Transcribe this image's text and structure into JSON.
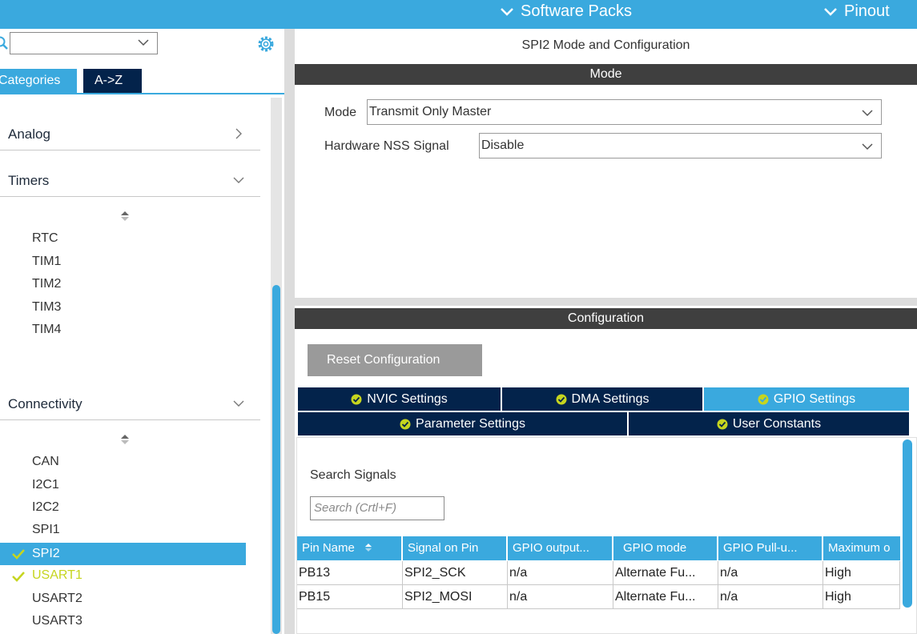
{
  "topbar": {
    "software_packs": "Software Packs",
    "pinout": "Pinout"
  },
  "sidebar": {
    "tabs": {
      "categories": "Categories",
      "az": "A->Z"
    },
    "categories": [
      {
        "label": "Analog",
        "state": "collapsed"
      },
      {
        "label": "Timers",
        "state": "expanded"
      },
      {
        "label": "Connectivity",
        "state": "expanded"
      }
    ],
    "timers_items": [
      "RTC",
      "TIM1",
      "TIM2",
      "TIM3",
      "TIM4"
    ],
    "connectivity_items": [
      "CAN",
      "I2C1",
      "I2C2",
      "SPI1",
      "SPI2",
      "USART1",
      "USART2",
      "USART3"
    ],
    "selected_item": "SPI2"
  },
  "main": {
    "title": "SPI2 Mode and Configuration",
    "mode_header": "Mode",
    "mode_label": "Mode",
    "mode_value": "Transmit Only Master",
    "nss_label": "Hardware NSS Signal",
    "nss_value": "Disable",
    "config_header": "Configuration",
    "reset_button": "Reset Configuration",
    "tabs": {
      "nvic": "NVIC Settings",
      "dma": "DMA Settings",
      "gpio": "GPIO Settings",
      "parameter": "Parameter Settings",
      "user_constants": "User Constants"
    },
    "active_tab": "GPIO Settings",
    "search_label": "Search Signals",
    "search_placeholder": "Search (Crtl+F)",
    "table": {
      "headers": [
        "Pin Name",
        "Signal on Pin",
        "GPIO output...",
        "GPIO mode",
        "GPIO Pull-u...",
        "Maximum o"
      ],
      "rows": [
        [
          "PB13",
          "SPI2_SCK",
          "n/a",
          "Alternate Fu...",
          "n/a",
          "High"
        ],
        [
          "PB15",
          "SPI2_MOSI",
          "n/a",
          "Alternate Fu...",
          "n/a",
          "High"
        ]
      ]
    }
  },
  "colors": {
    "accent": "#3aa9de",
    "navy": "#03234b",
    "bar": "#3f3f3f",
    "check_ok": "#c6d51f"
  }
}
